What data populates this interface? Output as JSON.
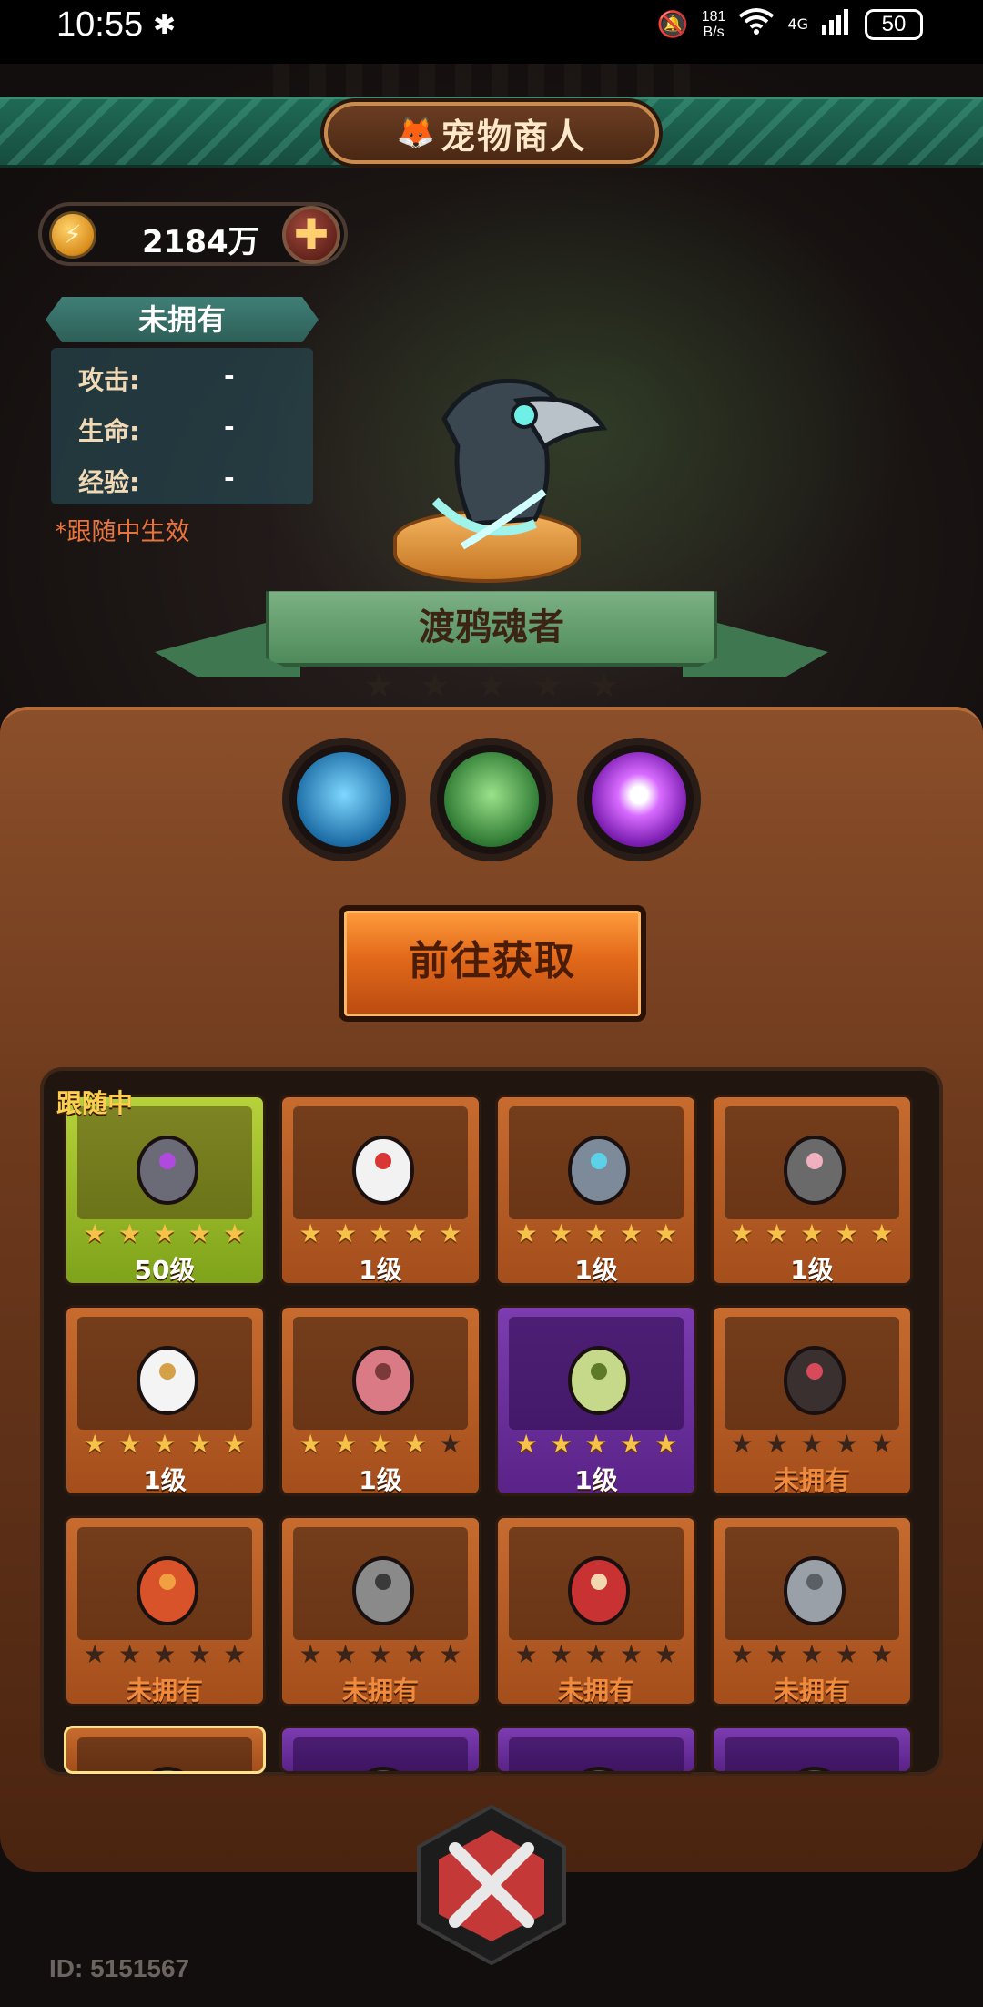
{
  "status_bar": {
    "time": "10:55",
    "net_speed_top": "181",
    "net_speed_bottom": "B/s",
    "network": "4G",
    "battery": "50"
  },
  "header": {
    "title": "宠物商人"
  },
  "currency": {
    "amount": "2184万",
    "coin_symbol": "⚡",
    "plus_symbol": "✚"
  },
  "stats": {
    "title": "未拥有",
    "rows": [
      {
        "label": "攻击:",
        "value": "-"
      },
      {
        "label": "生命:",
        "value": "-"
      },
      {
        "label": "经验:",
        "value": "-"
      }
    ],
    "note": "*跟随中生效"
  },
  "selected_pet": {
    "name": "渡鸦魂者",
    "stars": 0,
    "max_stars": 5
  },
  "skills": [
    {
      "name": "ghost-skill",
      "color": "#3fa7e0"
    },
    {
      "name": "claw-skill",
      "color": "#4a9e4a"
    },
    {
      "name": "chat-skill",
      "color": "#c14fe6"
    }
  ],
  "action": {
    "get_label": "前往获取"
  },
  "grid": {
    "following_label": "跟随中",
    "pets": [
      {
        "id": "bat-pet",
        "stars": 5,
        "level": "50级",
        "rarity": "green",
        "owned": true
      },
      {
        "id": "clown-pet",
        "stars": 5,
        "level": "1级",
        "rarity": "orange",
        "owned": true
      },
      {
        "id": "spider-pet",
        "stars": 5,
        "level": "1级",
        "rarity": "orange",
        "owned": true
      },
      {
        "id": "diver-pet",
        "stars": 5,
        "level": "1级",
        "rarity": "orange",
        "owned": true
      },
      {
        "id": "goose-pet",
        "stars": 5,
        "level": "1级",
        "rarity": "orange",
        "owned": true
      },
      {
        "id": "pig-pet",
        "stars": 4,
        "level": "1级",
        "rarity": "orange",
        "owned": true
      },
      {
        "id": "owl-pet",
        "stars": 5,
        "level": "1级",
        "rarity": "purple",
        "owned": true
      },
      {
        "id": "chest-pet",
        "stars": 0,
        "level": "未拥有",
        "rarity": "orange",
        "owned": false
      },
      {
        "id": "dragon-pet",
        "stars": 0,
        "level": "未拥有",
        "rarity": "orange",
        "owned": false
      },
      {
        "id": "knight-pet",
        "stars": 0,
        "level": "未拥有",
        "rarity": "orange",
        "owned": false
      },
      {
        "id": "daruma-pet",
        "stars": 0,
        "level": "未拥有",
        "rarity": "orange",
        "owned": false
      },
      {
        "id": "gauntlet-pet",
        "stars": 0,
        "level": "未拥有",
        "rarity": "orange",
        "owned": false
      },
      {
        "id": "partial-pet-1",
        "stars": 0,
        "level": "",
        "rarity": "gold",
        "owned": false
      },
      {
        "id": "partial-pet-2",
        "stars": 0,
        "level": "",
        "rarity": "purple",
        "owned": false
      },
      {
        "id": "partial-pet-3",
        "stars": 0,
        "level": "",
        "rarity": "purple",
        "owned": false
      },
      {
        "id": "partial-pet-4",
        "stars": 0,
        "level": "",
        "rarity": "purple",
        "owned": false
      }
    ]
  },
  "footer": {
    "player_id": "ID: 5151567"
  }
}
